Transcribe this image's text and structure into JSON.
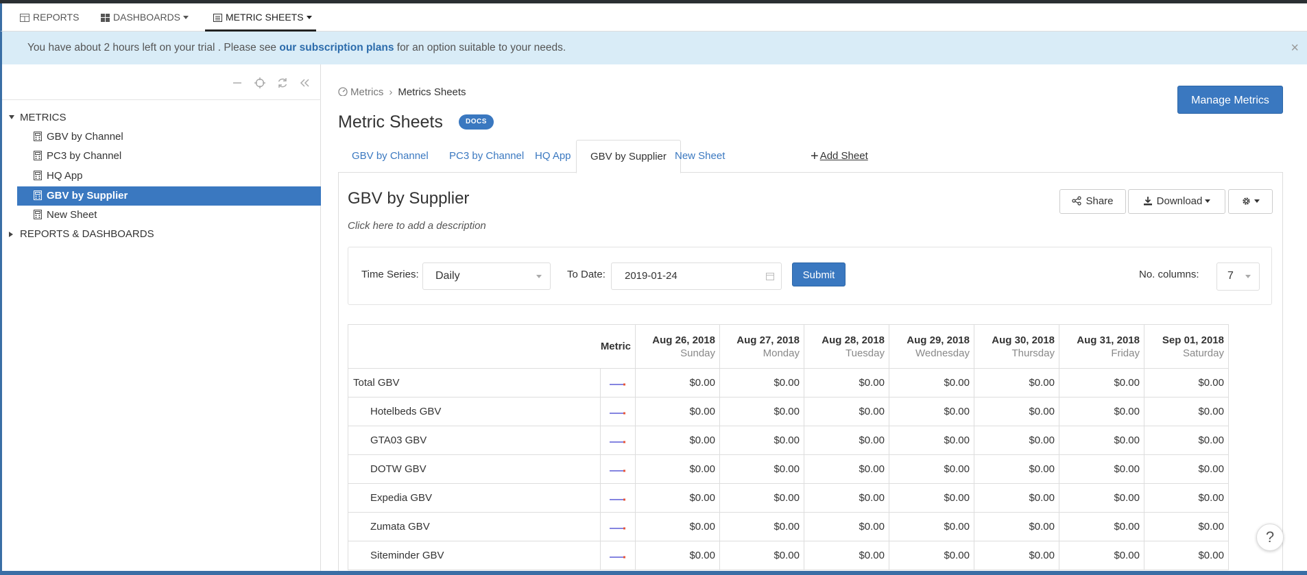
{
  "topnav": {
    "reports": "REPORTS",
    "dashboards": "DASHBOARDS",
    "metric_sheets": "METRIC SHEETS"
  },
  "trial": {
    "pre": "You have about 2 hours left on your trial . Please see ",
    "link": "our subscription plans",
    "post": " for an option suitable to your needs.",
    "close": "×"
  },
  "sidebar": {
    "metrics_label": "METRICS",
    "items": [
      {
        "label": "GBV by Channel"
      },
      {
        "label": "PC3 by Channel"
      },
      {
        "label": "HQ App"
      },
      {
        "label": "GBV by Supplier"
      },
      {
        "label": "New Sheet"
      }
    ],
    "reports_label": "REPORTS & DASHBOARDS"
  },
  "breadcrumb": {
    "root": "Metrics",
    "current": "Metrics Sheets"
  },
  "header": {
    "title": "Metric Sheets",
    "docs_badge": "DOCS",
    "manage_button": "Manage Metrics"
  },
  "tabs": [
    {
      "label": "GBV by Channel"
    },
    {
      "label": "PC3 by Channel"
    },
    {
      "label": "HQ App"
    },
    {
      "label": "GBV by Supplier"
    },
    {
      "label": "New Sheet"
    }
  ],
  "add_sheet": "Add Sheet",
  "sheet": {
    "title": "GBV by Supplier",
    "description": "Click here to add a description",
    "share": "Share",
    "download": "Download"
  },
  "filters": {
    "time_series_label": "Time Series:",
    "time_series_value": "Daily",
    "to_date_label": "To Date:",
    "to_date_value": "2019-01-24",
    "submit": "Submit",
    "columns_label": "No. columns:",
    "columns_value": "7"
  },
  "table": {
    "metric_header": "Metric",
    "dates": [
      {
        "date": "Aug 26, 2018",
        "day": "Sunday"
      },
      {
        "date": "Aug 27, 2018",
        "day": "Monday"
      },
      {
        "date": "Aug 28, 2018",
        "day": "Tuesday"
      },
      {
        "date": "Aug 29, 2018",
        "day": "Wednesday"
      },
      {
        "date": "Aug 30, 2018",
        "day": "Thursday"
      },
      {
        "date": "Aug 31, 2018",
        "day": "Friday"
      },
      {
        "date": "Sep 01, 2018",
        "day": "Saturday"
      }
    ],
    "rows": [
      {
        "name": "Total GBV",
        "values": [
          "$0.00",
          "$0.00",
          "$0.00",
          "$0.00",
          "$0.00",
          "$0.00",
          "$0.00"
        ]
      },
      {
        "name": "Hotelbeds GBV",
        "values": [
          "$0.00",
          "$0.00",
          "$0.00",
          "$0.00",
          "$0.00",
          "$0.00",
          "$0.00"
        ]
      },
      {
        "name": "GTA03 GBV",
        "values": [
          "$0.00",
          "$0.00",
          "$0.00",
          "$0.00",
          "$0.00",
          "$0.00",
          "$0.00"
        ]
      },
      {
        "name": "DOTW GBV",
        "values": [
          "$0.00",
          "$0.00",
          "$0.00",
          "$0.00",
          "$0.00",
          "$0.00",
          "$0.00"
        ]
      },
      {
        "name": "Expedia GBV",
        "values": [
          "$0.00",
          "$0.00",
          "$0.00",
          "$0.00",
          "$0.00",
          "$0.00",
          "$0.00"
        ]
      },
      {
        "name": "Zumata GBV",
        "values": [
          "$0.00",
          "$0.00",
          "$0.00",
          "$0.00",
          "$0.00",
          "$0.00",
          "$0.00"
        ]
      },
      {
        "name": "Siteminder GBV",
        "values": [
          "$0.00",
          "$0.00",
          "$0.00",
          "$0.00",
          "$0.00",
          "$0.00",
          "$0.00"
        ]
      }
    ]
  },
  "help": "?",
  "colors": {
    "primary": "#3a78c0",
    "trial_bg": "#d9ecf7",
    "spark_line": "#5b5bd6",
    "spark_end": "#e8563a"
  }
}
